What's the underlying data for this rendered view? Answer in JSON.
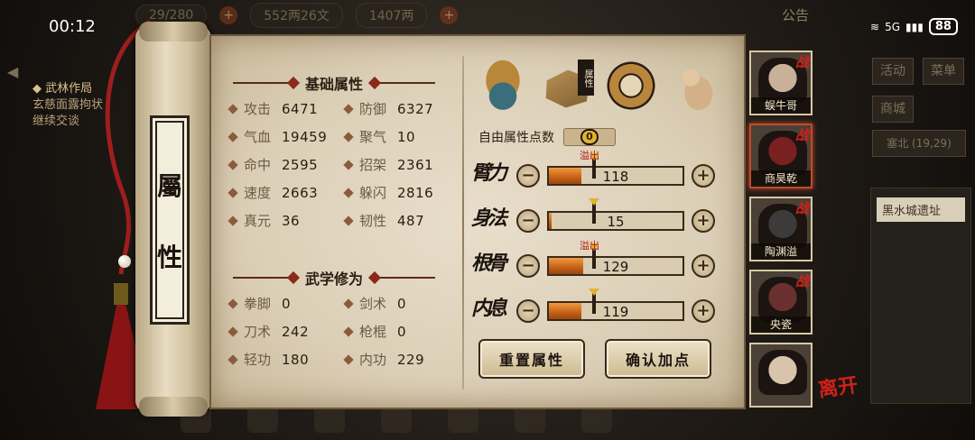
{
  "status_bar": {
    "time_left": "00:12",
    "time_right": "00:12",
    "battery": "88",
    "network": "5G"
  },
  "hud": {
    "top_left_num": "29/280",
    "money": "552两26文",
    "silver": "1407两",
    "announce": "公告",
    "quest_title": "武林作局",
    "quest_desc": [
      "玄慈面露拘状",
      "继续交谈"
    ],
    "right_buttons": {
      "activity": "活动",
      "menu": "菜单",
      "shop": "商城",
      "location": "塞北 (19,29)",
      "place": "黑水城遗址"
    }
  },
  "scroll": {
    "title_chars": [
      "屬",
      "性"
    ]
  },
  "basic": {
    "heading": "基础属性",
    "stats": [
      {
        "label": "攻击",
        "value": "6471"
      },
      {
        "label": "防御",
        "value": "6327"
      },
      {
        "label": "气血",
        "value": "19459"
      },
      {
        "label": "聚气",
        "value": "10"
      },
      {
        "label": "命中",
        "value": "2595"
      },
      {
        "label": "招架",
        "value": "2361"
      },
      {
        "label": "速度",
        "value": "2663"
      },
      {
        "label": "躲闪",
        "value": "2816"
      },
      {
        "label": "真元",
        "value": "36"
      },
      {
        "label": "韧性",
        "value": "487"
      }
    ]
  },
  "martial": {
    "heading": "武学修为",
    "stats": [
      {
        "label": "拳脚",
        "value": "0"
      },
      {
        "label": "剑术",
        "value": "0"
      },
      {
        "label": "刀术",
        "value": "242"
      },
      {
        "label": "枪棍",
        "value": "0"
      },
      {
        "label": "轻功",
        "value": "180"
      },
      {
        "label": "内功",
        "value": "229"
      }
    ]
  },
  "tabs": {
    "attr_tag": "属性"
  },
  "alloc": {
    "free_label": "自由属性点数",
    "free_points": "0",
    "rows": [
      {
        "name": "臂力",
        "value": "118",
        "overflow": "溢出",
        "fill": 0.24
      },
      {
        "name": "身法",
        "value": "15",
        "overflow": "",
        "fill": 0.02
      },
      {
        "name": "根骨",
        "value": "129",
        "overflow": "溢出",
        "fill": 0.26
      },
      {
        "name": "内息",
        "value": "119",
        "overflow": "",
        "fill": 0.24
      }
    ],
    "minus": "−",
    "plus": "+",
    "reset": "重置属性",
    "confirm": "确认加点"
  },
  "roster": [
    {
      "name": "蜈牛哥",
      "tag": "战"
    },
    {
      "name": "商昊乾",
      "tag": "战"
    },
    {
      "name": "陶渊溢",
      "tag": "战"
    },
    {
      "name": "央瓷",
      "tag": "战"
    },
    {
      "name": "",
      "tag": ""
    }
  ],
  "leave": "离开",
  "colors": {
    "accent": "#c24a2a",
    "bar_fill": "#c46016",
    "overflow": "#b01515"
  }
}
